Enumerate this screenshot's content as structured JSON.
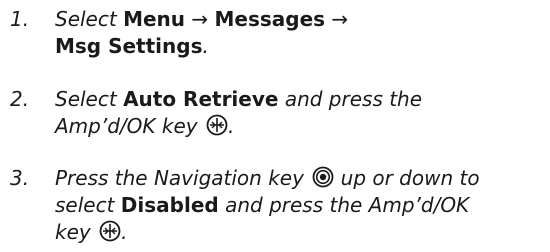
{
  "steps": [
    {
      "number": "1.",
      "select_word": "Select",
      "menu": "Menu",
      "arrow1": "→",
      "messages": "Messages",
      "arrow2": "→",
      "msg_settings": "Msg Settings",
      "period": "."
    },
    {
      "number": "2.",
      "select_word": "Select",
      "auto_retrieve": "Auto Retrieve",
      "press_text": "and press the",
      "key_text": "Amp’d/OK key",
      "period": "."
    },
    {
      "number": "3.",
      "press_nav": "Press the Navigation key",
      "up_down": "up or down to",
      "select_word": "select",
      "disabled": "Disabled",
      "press_text": "and press the Amp’d/OK",
      "key_word": "key",
      "period": "."
    }
  ],
  "icons": {
    "ok_key": "amp-ok-key-icon",
    "nav_key": "navigation-key-icon"
  }
}
